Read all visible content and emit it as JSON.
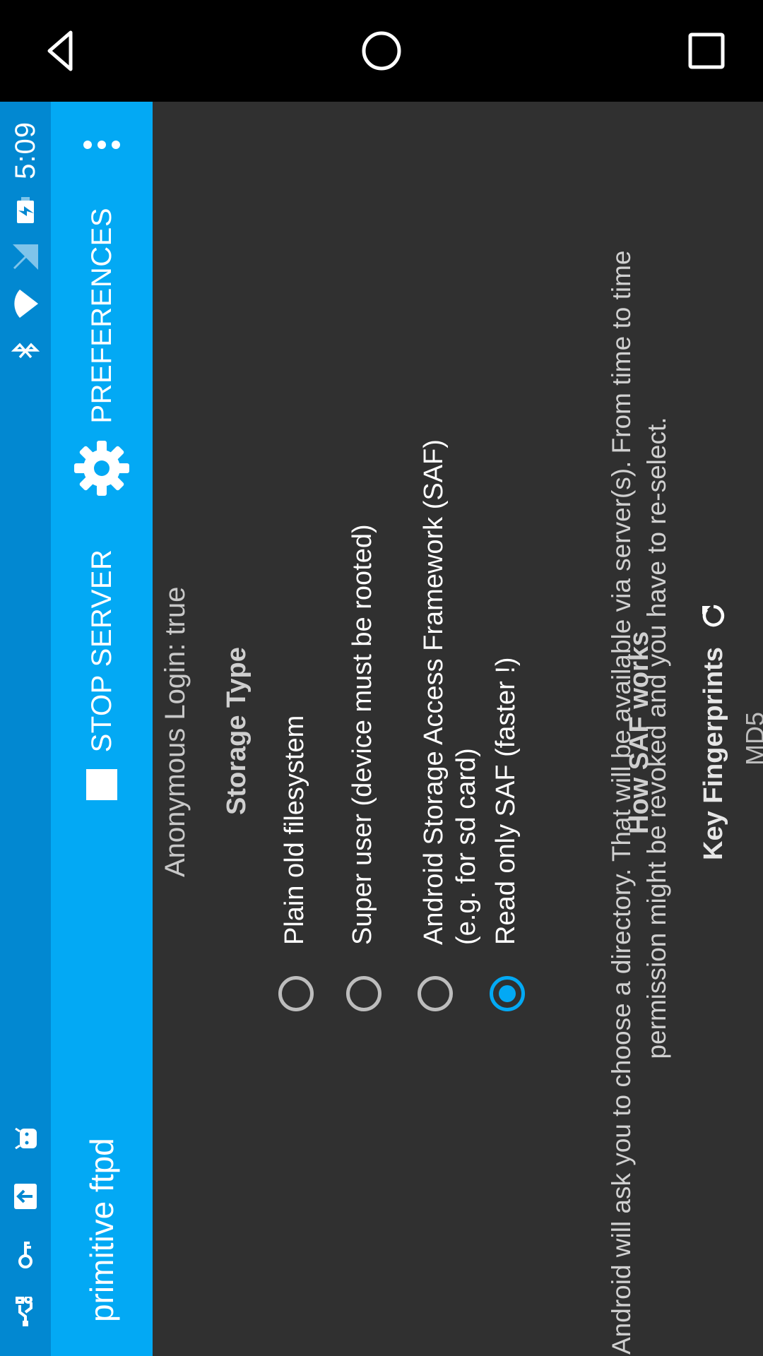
{
  "status_bar": {
    "time": "5:09",
    "left_icons": [
      "usb-debug-icon",
      "key-icon",
      "upload-icon",
      "android-icon"
    ],
    "right_icons": [
      "bluetooth-icon",
      "wifi-icon",
      "no-sim-icon",
      "battery-charging-icon"
    ]
  },
  "app_bar": {
    "title": "primitive ftpd",
    "stop_label": "STOP SERVER",
    "preferences_label": "PREFERENCES",
    "overflow_icon": "more-vert-icon",
    "color": "#03a9f4"
  },
  "content": {
    "anonymous_login": "Anonymous Login: true",
    "storage_heading": "Storage Type",
    "storage_options": [
      {
        "label_lines": [
          "Plain old filesystem"
        ],
        "checked": false
      },
      {
        "label_lines": [
          "Super user (device must be rooted)"
        ],
        "checked": false
      },
      {
        "label_lines": [
          "Android Storage Access Framework (SAF)",
          "(e.g. for sd card)"
        ],
        "checked": false
      },
      {
        "label_lines": [
          "Read only SAF (faster !)"
        ],
        "checked": true
      }
    ],
    "saf_heading": "How SAF works",
    "saf_description_line1": "Android will ask you to choose a directory. That will be available via server(s). From time to time",
    "saf_description_line2": "permission might be revoked and you have to re-select.",
    "fingerprints_heading": "Key Fingerprints",
    "md5_label": "MD5"
  },
  "nav_bar": {
    "buttons": [
      "back-icon",
      "home-icon",
      "recents-icon"
    ]
  }
}
